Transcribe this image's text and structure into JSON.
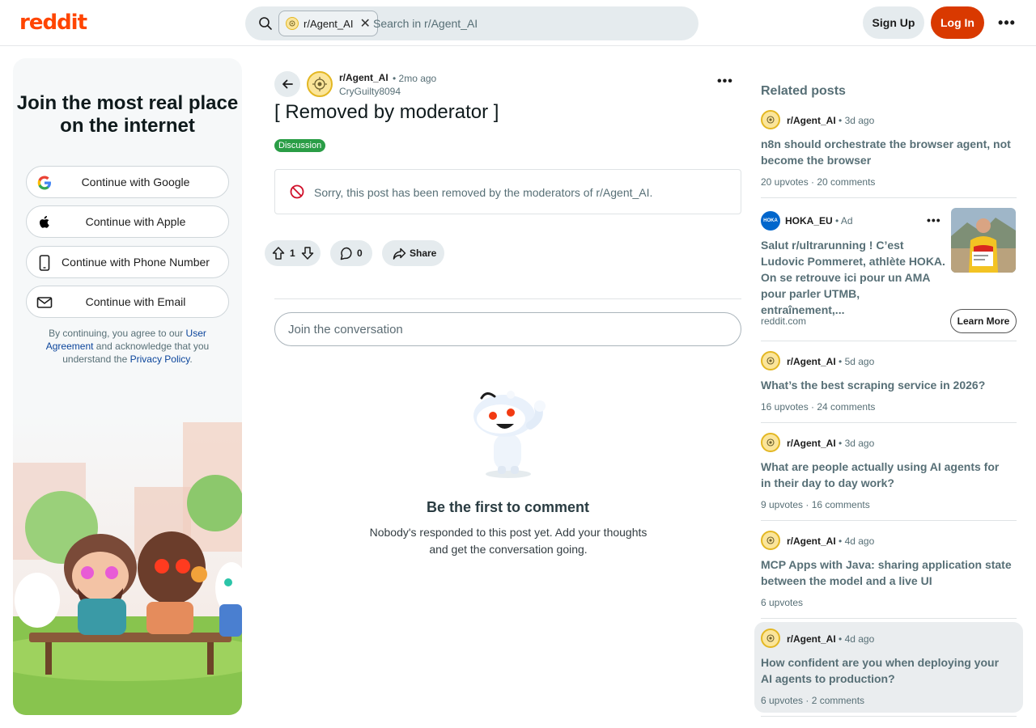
{
  "header": {
    "logo": "reddit",
    "search_chip": "r/Agent_AI",
    "search_placeholder": "Search in r/Agent_AI",
    "sign_up": "Sign Up",
    "log_in": "Log In",
    "more_icon": "more-horizontal-icon"
  },
  "left_panel": {
    "title": "Join the most real place on the internet",
    "buttons": [
      {
        "label": "Continue with Google",
        "icon": "google-icon"
      },
      {
        "label": "Continue with Apple",
        "icon": "apple-icon"
      },
      {
        "label": "Continue with Phone Number",
        "icon": "phone-icon"
      },
      {
        "label": "Continue with Email",
        "icon": "email-icon"
      }
    ],
    "legal_prefix": "By continuing, you agree to our ",
    "legal_link1": "User Agreement",
    "legal_mid": " and acknowledge that you understand the ",
    "legal_link2": "Privacy Policy",
    "legal_suffix": "."
  },
  "post": {
    "subreddit": "r/Agent_AI",
    "time": "• 2mo ago",
    "author": "CryGuilty8094",
    "title": "[ Removed by moderator ]",
    "flair": "Discussion",
    "flair_color": "#2a9d46",
    "removed_notice": "Sorry, this post has been removed by the moderators of r/Agent_AI.",
    "votes": "1",
    "comments": "0",
    "share": "Share"
  },
  "comments": {
    "placeholder": "Join the conversation",
    "empty_title": "Be the first to comment",
    "empty_desc": "Nobody's responded to this post yet. Add your thoughts and get the conversation going."
  },
  "related": {
    "title": "Related posts",
    "posts": [
      {
        "sub": "r/Agent_AI",
        "time": "• 3d ago",
        "title": "n8n should orchestrate the browser agent, not become the browser",
        "stats": "20 upvotes · 20 comments"
      },
      {
        "sub": "r/Agent_AI",
        "time": "• 5d ago",
        "title": "What’s the best scraping service in 2026?",
        "stats": "16 upvotes · 24 comments"
      },
      {
        "sub": "r/Agent_AI",
        "time": "• 3d ago",
        "title": "What are people actually using AI agents for in their day to day work?",
        "stats": "9 upvotes · 16 comments"
      },
      {
        "sub": "r/Agent_AI",
        "time": "• 4d ago",
        "title": "MCP Apps with Java: sharing application state between the model and a live UI",
        "stats": "6 upvotes"
      },
      {
        "sub": "r/Agent_AI",
        "time": "• 4d ago",
        "title": "How confident are you when deploying your AI agents to production?",
        "stats": "6 upvotes · 2 comments"
      }
    ],
    "ad": {
      "logo_text": "HOKA",
      "name": "HOKA_EU",
      "label": "• Ad",
      "text": "Salut r/ultrarunning ! C’est Ludovic Pommeret, athlète HOKA. On se retrouve ici pour un AMA pour parler UTMB, entraînement,...",
      "domain": "reddit.com",
      "cta": "Learn More"
    }
  }
}
